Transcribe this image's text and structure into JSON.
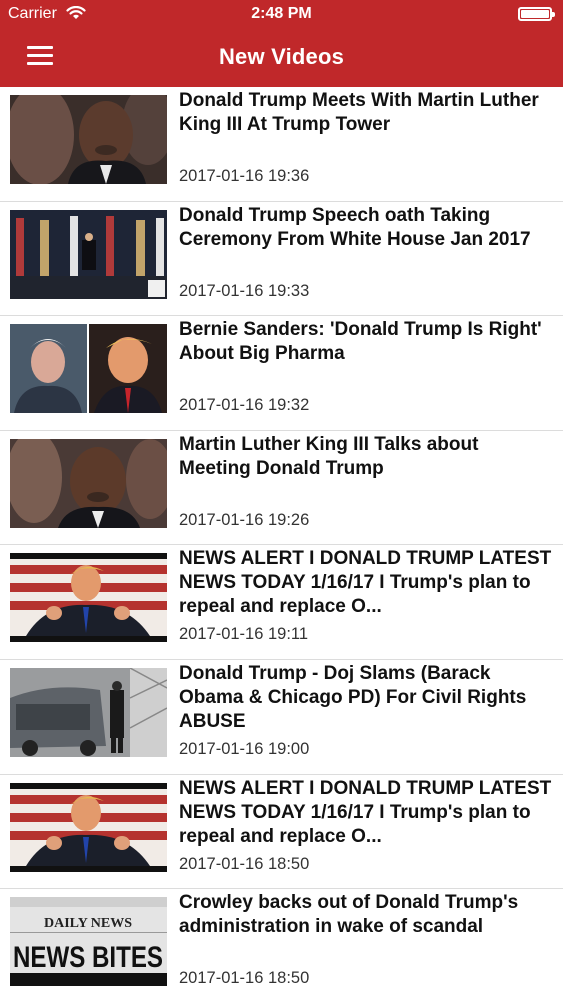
{
  "status_bar": {
    "carrier": "Carrier",
    "time": "2:48 PM"
  },
  "header": {
    "title": "New Videos"
  },
  "videos": [
    {
      "title": "Donald Trump Meets With Martin Luther King III At Trump Tower",
      "date": "2017-01-16 19:36",
      "thumbnail": "man-closeup"
    },
    {
      "title": "Donald Trump Speech oath Taking Ceremony From White House Jan 2017",
      "date": "2017-01-16 19:33",
      "thumbnail": "podium-flags"
    },
    {
      "title": "Bernie Sanders: 'Donald Trump Is Right' About Big Pharma",
      "date": "2017-01-16 19:32",
      "thumbnail": "split-portraits"
    },
    {
      "title": "Martin Luther King III Talks about Meeting Donald Trump",
      "date": "2017-01-16 19:26",
      "thumbnail": "man-closeup"
    },
    {
      "title": "NEWS ALERT I DONALD TRUMP LATEST NEWS TODAY 1/16/17 I Trump's plan to repeal and replace O...",
      "date": "2017-01-16 19:11",
      "thumbnail": "speaker-flag"
    },
    {
      "title": "Donald Trump - Doj Slams (Barack Obama & Chicago PD) For Civil Rights ABUSE",
      "date": "2017-01-16 19:00",
      "thumbnail": "street-car"
    },
    {
      "title": "NEWS ALERT I DONALD TRUMP LATEST NEWS TODAY 1/16/17 I Trump's plan to repeal and replace O...",
      "date": "2017-01-16 18:50",
      "thumbnail": "speaker-flag"
    },
    {
      "title": "Crowley backs out of Donald Trump's administration in wake of scandal",
      "date": "2017-01-16 18:50",
      "thumbnail": "news-logo",
      "thumbnail_text": {
        "line1": "DAILY NEWS",
        "line2": "NEWS BITES"
      }
    }
  ]
}
